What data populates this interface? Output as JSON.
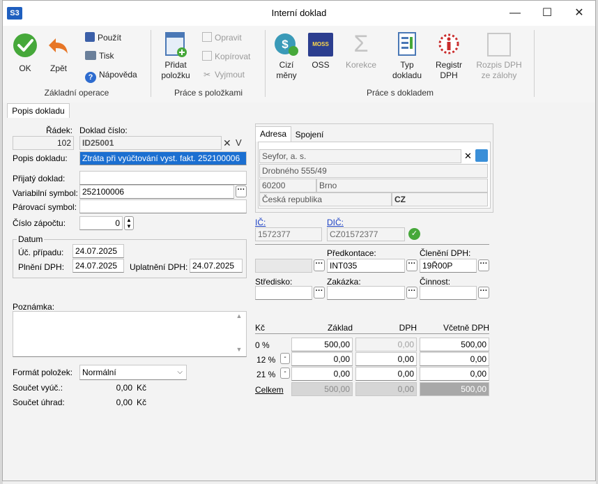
{
  "window": {
    "app_badge": "S3",
    "title": "Interní doklad",
    "minimize": "—",
    "maximize": "☐",
    "close": "✕"
  },
  "ribbon": {
    "ok": "OK",
    "back": "Zpět",
    "use": "Použít",
    "print": "Tisk",
    "help": "Nápověda",
    "group_basic": "Základní operace",
    "add_item_1": "Přidat",
    "add_item_2": "položku",
    "edit": "Opravit",
    "copy": "Kopírovat",
    "cut": "Vyjmout",
    "group_items": "Práce s položkami",
    "foreign_1": "Cizí",
    "foreign_2": "měny",
    "oss": "OSS",
    "oss_badge": "MOSS",
    "correction": "Korekce",
    "doc_type_1": "Typ",
    "doc_type_2": "dokladu",
    "vat_reg_1": "Registr",
    "vat_reg_2": "DPH",
    "vat_split_1": "Rozpis DPH",
    "vat_split_2": "ze zálohy",
    "group_doc": "Práce s dokladem"
  },
  "tabs": {
    "active": "Popis dokladu"
  },
  "form": {
    "row_label": "Řádek:",
    "row_value": "102",
    "doc_no_label": "Doklad číslo:",
    "doc_no_value": "ID25001",
    "doc_no_clear": "✕",
    "doc_no_suffix": "V",
    "desc_label": "Popis dokladu:",
    "desc_value": "Ztráta při vyúčtování vyst. fakt. 252100006",
    "received_label": "Přijatý doklad:",
    "received_value": "",
    "varsym_label": "Variabilní symbol:",
    "varsym_value": "252100006",
    "pairing_label": "Párovací symbol:",
    "pairing_value": "",
    "offset_label": "Číslo zápočtu:",
    "offset_value": "0",
    "date_group": "Datum",
    "acct_case_label": "Úč. případu:",
    "acct_case_value": "24.07.2025",
    "vat_perf_label": "Plnění DPH:",
    "vat_perf_value": "24.07.2025",
    "vat_claim_label": "Uplatnění DPH:",
    "vat_claim_value": "24.07.2025",
    "note_label": "Poznámka:",
    "note_value": "",
    "item_format_label": "Formát položek:",
    "item_format_value": "Normální",
    "sum_billing_label": "Součet vyúč.:",
    "sum_billing_value": "0,00",
    "sum_billing_curr": "Kč",
    "sum_payment_label": "Součet úhrad:",
    "sum_payment_value": "0,00",
    "sum_payment_curr": "Kč"
  },
  "address": {
    "tab_address": "Adresa",
    "tab_connection": "Spojení",
    "name": "Seyfor, a. s.",
    "street": "Drobného 555/49",
    "zip": "60200",
    "city": "Brno",
    "country": "Česká republika",
    "country_code": "CZ",
    "clear_icon": "✕",
    "ic_label": "IČ:",
    "ic_value": "1572377",
    "dic_label": "DIČ:",
    "dic_value": "CZ01572377"
  },
  "accounting": {
    "precontact_label": "Předkontace:",
    "precontact_value": "INT035",
    "vat_class_label": "Členění DPH:",
    "vat_class_value": "19Ř00P",
    "center_label": "Středisko:",
    "center_value": "",
    "order_label": "Zakázka:",
    "order_value": "",
    "activity_label": "Činnost:",
    "activity_value": ""
  },
  "vat_table": {
    "col_currency": "Kč",
    "col_base": "Základ",
    "col_vat": "DPH",
    "col_total": "Včetně DPH",
    "rows": [
      {
        "rate": "0 %",
        "base": "500,00",
        "vat": "0,00",
        "total": "500,00"
      },
      {
        "rate": "12 %",
        "base": "0,00",
        "vat": "0,00",
        "total": "0,00"
      },
      {
        "rate": "21 %",
        "base": "0,00",
        "vat": "0,00",
        "total": "0,00"
      }
    ],
    "sum_label": "Celkem",
    "sum_base": "500,00",
    "sum_vat": "0,00",
    "sum_total": "500,00"
  }
}
